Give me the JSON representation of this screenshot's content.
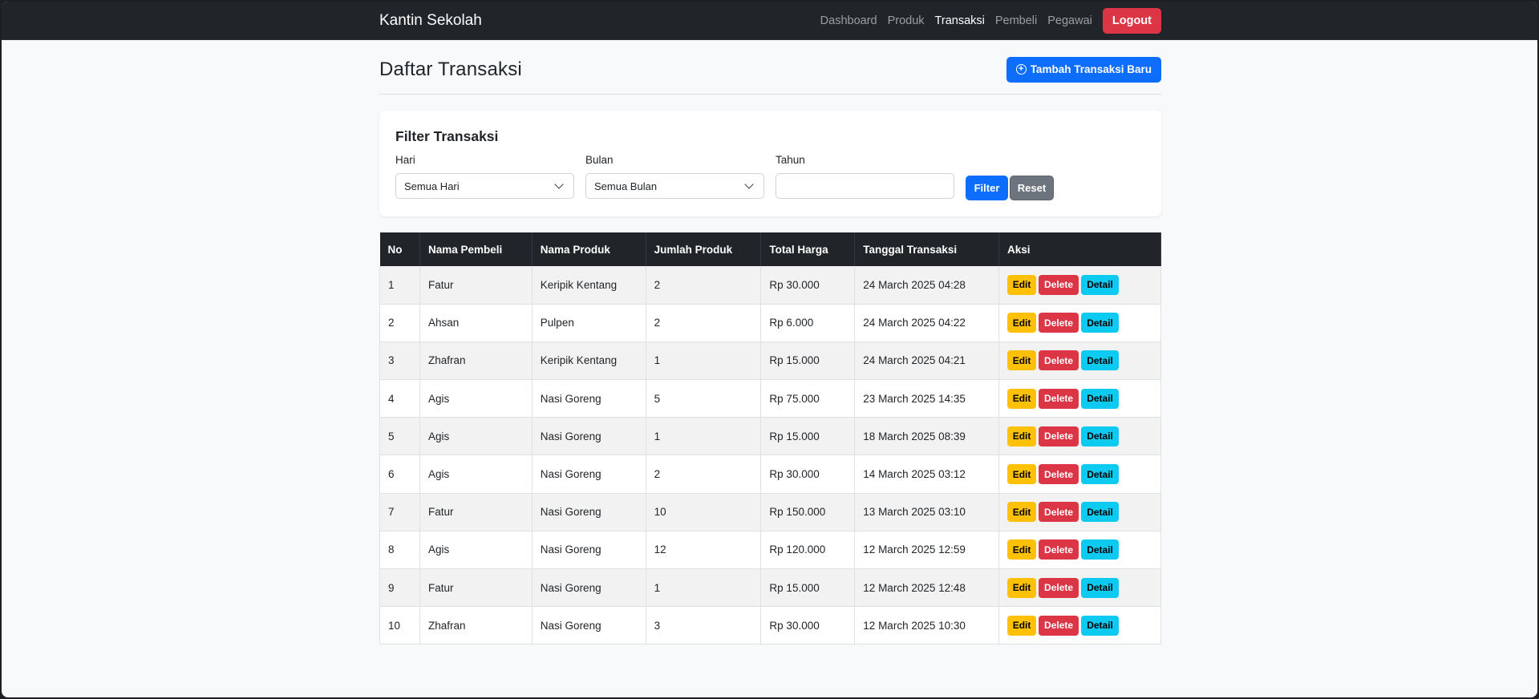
{
  "nav": {
    "brand": "Kantin Sekolah",
    "links": [
      {
        "label": "Dashboard",
        "active": false
      },
      {
        "label": "Produk",
        "active": false
      },
      {
        "label": "Transaksi",
        "active": true
      },
      {
        "label": "Pembeli",
        "active": false
      },
      {
        "label": "Pegawai",
        "active": false
      }
    ],
    "logout_label": "Logout"
  },
  "header": {
    "title": "Daftar Transaksi",
    "add_button_label": "Tambah Transaksi Baru"
  },
  "filter": {
    "title": "Filter Transaksi",
    "day_label": "Hari",
    "day_value": "Semua Hari",
    "month_label": "Bulan",
    "month_value": "Semua Bulan",
    "year_label": "Tahun",
    "year_value": "",
    "filter_label": "Filter",
    "reset_label": "Reset"
  },
  "table": {
    "headers": [
      "No",
      "Nama Pembeli",
      "Nama Produk",
      "Jumlah Produk",
      "Total Harga",
      "Tanggal Transaksi",
      "Aksi"
    ],
    "action_labels": {
      "edit": "Edit",
      "delete": "Delete",
      "detail": "Detail"
    },
    "rows": [
      [
        "1",
        "Fatur",
        "Keripik Kentang",
        "2",
        "Rp 30.000",
        "24 March 2025 04:28"
      ],
      [
        "2",
        "Ahsan",
        "Pulpen",
        "2",
        "Rp 6.000",
        "24 March 2025 04:22"
      ],
      [
        "3",
        "Zhafran",
        "Keripik Kentang",
        "1",
        "Rp 15.000",
        "24 March 2025 04:21"
      ],
      [
        "4",
        "Agis",
        "Nasi Goreng",
        "5",
        "Rp 75.000",
        "23 March 2025 14:35"
      ],
      [
        "5",
        "Agis",
        "Nasi Goreng",
        "1",
        "Rp 15.000",
        "18 March 2025 08:39"
      ],
      [
        "6",
        "Agis",
        "Nasi Goreng",
        "2",
        "Rp 30.000",
        "14 March 2025 03:12"
      ],
      [
        "7",
        "Fatur",
        "Nasi Goreng",
        "10",
        "Rp 150.000",
        "13 March 2025 03:10"
      ],
      [
        "8",
        "Agis",
        "Nasi Goreng",
        "12",
        "Rp 120.000",
        "12 March 2025 12:59"
      ],
      [
        "9",
        "Fatur",
        "Nasi Goreng",
        "1",
        "Rp 15.000",
        "12 March 2025 12:48"
      ],
      [
        "10",
        "Zhafran",
        "Nasi Goreng",
        "3",
        "Rp 30.000",
        "12 March 2025 10:30"
      ]
    ]
  },
  "colors": {
    "navbar": "#212529",
    "primary": "#0d6efd",
    "danger": "#dc3545",
    "warning": "#ffc107",
    "info": "#0dcaf0",
    "secondary": "#6c757d"
  }
}
